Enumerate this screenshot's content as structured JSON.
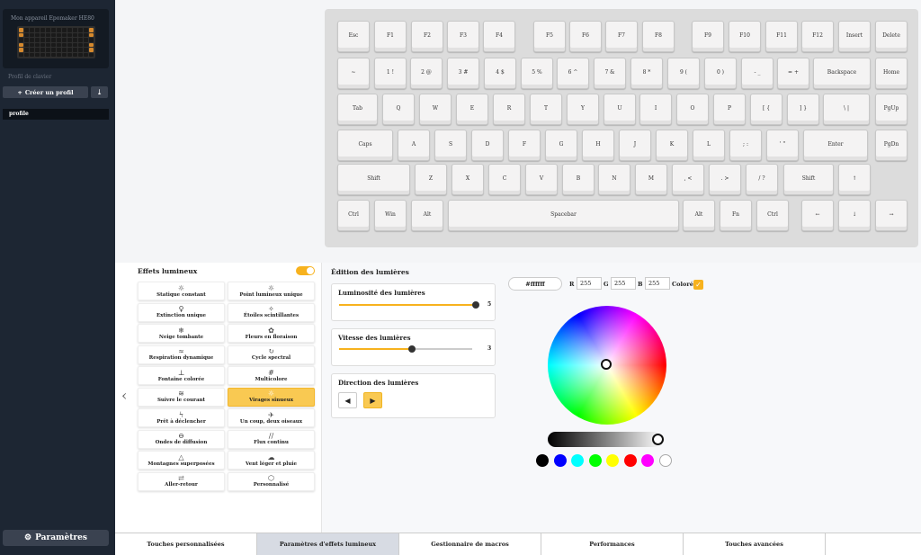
{
  "sidebar": {
    "device_name": "Mon appareil Epomaker HE80",
    "profile_section_label": "Profil de clavier",
    "create_profile_label": "Créer un profil",
    "profiles": [
      "profile"
    ],
    "settings_label": "Paramètres"
  },
  "keyboard": {
    "rows": [
      [
        "Esc",
        "F1",
        "F2",
        "F3",
        "F4",
        "F5",
        "F6",
        "F7",
        "F8",
        "F9",
        "F10",
        "F11",
        "F12",
        "Insert",
        "Delete"
      ],
      [
        "~",
        "1 !",
        "2 @",
        "3 #",
        "4 $",
        "5 %",
        "6 ^",
        "7 &",
        "8 *",
        "9 (",
        "0 )",
        "- _",
        "= +",
        "Backspace",
        "Home"
      ],
      [
        "Tab",
        "Q",
        "W",
        "E",
        "R",
        "T",
        "Y",
        "U",
        "I",
        "O",
        "P",
        "[ {",
        "] }",
        "\\ |",
        "PgUp"
      ],
      [
        "Caps",
        "A",
        "S",
        "D",
        "F",
        "G",
        "H",
        "J",
        "K",
        "L",
        "; :",
        "' \"",
        "Enter",
        "PgDn"
      ],
      [
        "Shift",
        "Z",
        "X",
        "C",
        "V",
        "B",
        "N",
        "M",
        ", <",
        ". >",
        "/ ?",
        "Shift",
        "↑"
      ],
      [
        "Ctrl",
        "Win",
        "Alt",
        "Spacebar",
        "Alt",
        "Fn",
        "Ctrl",
        "←",
        "↓",
        "→"
      ]
    ]
  },
  "effects": {
    "title": "Effets lumineux",
    "enabled": true,
    "items": [
      {
        "label": "Statique constant",
        "icon": "☼"
      },
      {
        "label": "Point lumineux unique",
        "icon": "☼"
      },
      {
        "label": "Extinction unique",
        "icon": "♀"
      },
      {
        "label": "Étoiles scintillantes",
        "icon": "✧"
      },
      {
        "label": "Neige tombante",
        "icon": "❄"
      },
      {
        "label": "Fleurs en floraison",
        "icon": "✿"
      },
      {
        "label": "Respiration dynamique",
        "icon": "≈"
      },
      {
        "label": "Cycle spectral",
        "icon": "↻"
      },
      {
        "label": "Fontaine colorée",
        "icon": "⊥"
      },
      {
        "label": "Multicolore",
        "icon": "#"
      },
      {
        "label": "Suivre le courant",
        "icon": "≋"
      },
      {
        "label": "Virages sinueux",
        "icon": "☼",
        "selected": true
      },
      {
        "label": "Prêt à déclencher",
        "icon": "ϟ"
      },
      {
        "label": "Un coup, deux oiseaux",
        "icon": "✈"
      },
      {
        "label": "Ondes de diffusion",
        "icon": "⊖"
      },
      {
        "label": "Flux continu",
        "icon": "∕∕"
      },
      {
        "label": "Montagnes superposées",
        "icon": "△"
      },
      {
        "label": "Vent léger et pluie",
        "icon": "☁"
      },
      {
        "label": "Aller-retour",
        "icon": "⇄"
      },
      {
        "label": "Personnalisé",
        "icon": "⬡"
      }
    ]
  },
  "editor": {
    "title": "Édition des lumières",
    "brightness": {
      "label": "Luminosité des lumières",
      "value": "5",
      "fraction": 1.0
    },
    "speed": {
      "label": "Vitesse des lumières",
      "value": "3",
      "fraction": 0.55
    },
    "direction": {
      "label": "Direction des lumières",
      "left_icon": "◀",
      "right_icon": "▶"
    },
    "color": {
      "hex": "#ffffff",
      "r_label": "R",
      "r": "255",
      "g_label": "G",
      "g": "255",
      "b_label": "B",
      "b": "255",
      "colored_label": "Coloré"
    },
    "swatches": [
      "#000000",
      "#0000ff",
      "#00ffff",
      "#00ff00",
      "#ffff00",
      "#ff0000",
      "#ff00ff",
      "#ffffff"
    ]
  },
  "tabs": [
    {
      "label": "Touches personnalisées"
    },
    {
      "label": "Paramètres d'effets lumineux",
      "selected": true
    },
    {
      "label": "Gestionnaire de macros"
    },
    {
      "label": "Performances"
    },
    {
      "label": "Touches avancées"
    }
  ]
}
